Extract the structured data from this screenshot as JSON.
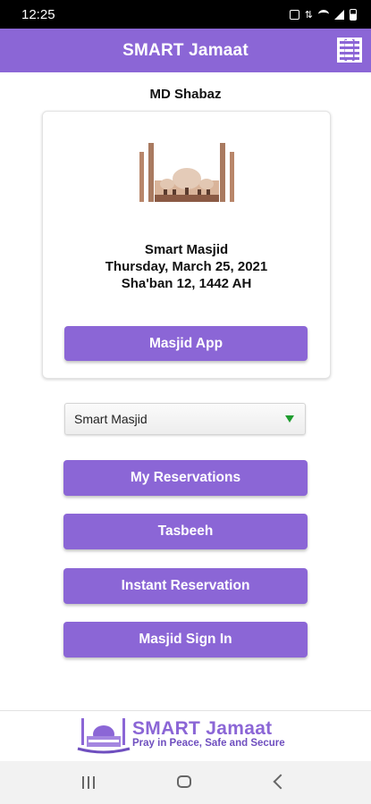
{
  "status_bar": {
    "time": "12:25",
    "icons": [
      "screenshot-icon",
      "data-icon",
      "wifi-icon",
      "signal-icon",
      "battery-icon"
    ]
  },
  "app_bar": {
    "title": "SMART Jamaat",
    "action_icon": "qr-code-icon"
  },
  "user": {
    "name": "MD Shabaz"
  },
  "masjid_card": {
    "image_icon": "mosque-image",
    "masjid_name": "Smart Masjid",
    "gregorian_date": "Thursday, March 25, 2021",
    "hijri_date": "Sha'ban 12, 1442 AH",
    "button_label": "Masjid App"
  },
  "masjid_select": {
    "selected": "Smart Masjid"
  },
  "actions": {
    "reservations": "My Reservations",
    "tasbeeh": "Tasbeeh",
    "instant_reservation": "Instant Reservation",
    "sign_in": "Masjid Sign In"
  },
  "footer": {
    "brand": "SMART Jamaat",
    "tagline": "Pray in Peace, Safe and Secure"
  },
  "colors": {
    "primary": "#8b66d6",
    "dropdown_arrow": "#1f9d2f"
  }
}
